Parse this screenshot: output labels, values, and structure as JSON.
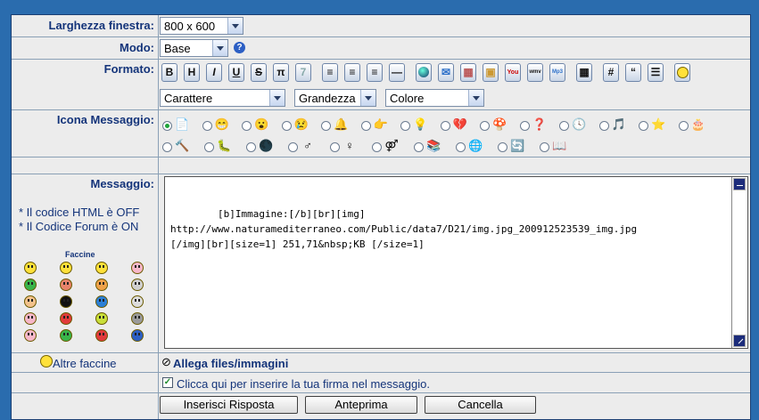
{
  "window": {
    "size_label": "Larghezza finestra:",
    "size_value": "800 x 600"
  },
  "mode": {
    "label": "Modo:",
    "value": "Base",
    "help_icon": "help-icon"
  },
  "format": {
    "label": "Formato:",
    "toolbar": [
      "B",
      "H",
      "I",
      "U",
      "S",
      "π",
      "",
      "",
      "",
      "",
      "",
      "",
      "",
      "",
      "",
      "",
      "",
      "",
      "",
      "",
      "",
      "#",
      "“",
      "",
      ""
    ],
    "font_select": "Carattere",
    "size_select": "Grandezza",
    "color_select": "Colore"
  },
  "message_icon": {
    "label": "Icona Messaggio:"
  },
  "message": {
    "label": "Messaggio:",
    "html_note": "* Il codice HTML è OFF",
    "forum_note": "* Il Codice Forum è ON",
    "faces_title": "Faccine",
    "text": "[b]Immagine:[/b][br][img]\nhttp://www.naturamediterraneo.com/Public/data7/D21/img.jpg_200912523539_img.jpg\n[/img][br][size=1] 251,71&nbsp;KB [/size=1]"
  },
  "more_faces": "Altre faccine",
  "attach": "Allega files/immagini",
  "signature": "Clicca qui per inserire la tua firma nel messaggio.",
  "buttons": {
    "submit": "Inserisci Risposta",
    "preview": "Anteprima",
    "cancel": "Cancella"
  },
  "colors": {
    "accent": "#14347a",
    "border": "#8aa0b6",
    "bg": "#2a6cae"
  }
}
